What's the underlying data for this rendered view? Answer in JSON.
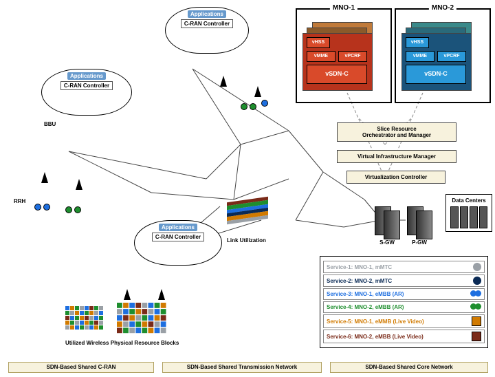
{
  "clouds": {
    "top": {
      "apps": "Applications",
      "ctrl": "C-RAN Controller"
    },
    "left": {
      "apps": "Applications",
      "ctrl": "C-RAN Controller"
    },
    "bottom": {
      "apps": "Applications",
      "ctrl": "C-RAN Controller"
    }
  },
  "labels": {
    "bbu": "BBU",
    "rrh": "RRH",
    "link_util": "Link Utilization",
    "prb": "Utilized Wireless Physical Resource Blocks",
    "sgw": "S-GW",
    "pgw": "P-GW",
    "dc": "Data Centers"
  },
  "mno": {
    "one": {
      "title": "MNO-1",
      "vhss": "vHSS",
      "vmme": "vMME",
      "vpcrf": "vPCRF",
      "vsdn": "vSDN-C",
      "colors": {
        "back1": "#c07a3a",
        "back2": "#8a5a2a",
        "front": "#b7331c",
        "accent": "#d94a2a"
      }
    },
    "two": {
      "title": "MNO-2",
      "vhss": "vHSS",
      "vmme": "vMME",
      "vpcrf": "vPCRF",
      "vsdn": "vSDN-C",
      "colors": {
        "back1": "#3a8a8a",
        "back2": "#2a6a7a",
        "front": "#1b537a",
        "accent": "#2a99d9"
      }
    }
  },
  "ctrl": {
    "slice": "Slice Resource\nOrchestrator and Manager",
    "vim": "Virtual Infrastructure Manager",
    "vc": "Virtualization Controller"
  },
  "sdn_bars": {
    "cran": "SDN-Based Shared C-RAN",
    "trans": "SDN-Based Shared Transmission Network",
    "core": "SDN-Based Shared Core Network"
  },
  "legend": {
    "rows": [
      {
        "text": "Service-1: MNO-1, mMTC",
        "color": "#9aa0a6",
        "icon": "tree-gray"
      },
      {
        "text": "Service-2: MNO-2, mMTC",
        "color": "#0a2a55",
        "icon": "tree-dark"
      },
      {
        "text": "Service-3: MNO-1, eMBB (AR)",
        "color": "#1e6fe0",
        "icon": "dots-blue"
      },
      {
        "text": "Service-4: MNO-2, eMBB (AR)",
        "color": "#1e8e2e",
        "icon": "dots-green"
      },
      {
        "text": "Service-5: MNO-1, eMMB (Live Video)",
        "color": "#d17a00",
        "icon": "cube-orange"
      },
      {
        "text": "Service-6: MNO-2, eMBB (Live Video)",
        "color": "#7a2a18",
        "icon": "cube-brown"
      }
    ]
  },
  "chart_data": null
}
